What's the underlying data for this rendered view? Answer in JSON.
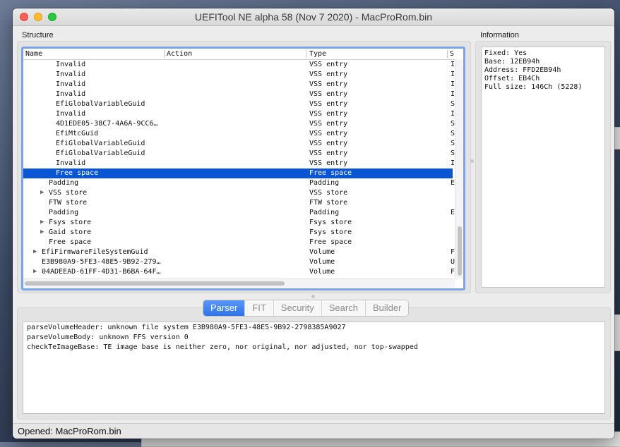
{
  "window": {
    "title": "UEFITool NE alpha 58 (Nov  7 2020) - MacProRom.bin"
  },
  "structure": {
    "label": "Structure",
    "columns": [
      "Name",
      "Action",
      "Type",
      "S"
    ],
    "rows": [
      {
        "name": "Invalid",
        "type": "VSS entry",
        "sub": "I",
        "indent": 3,
        "expandable": false,
        "selected": false
      },
      {
        "name": "Invalid",
        "type": "VSS entry",
        "sub": "I",
        "indent": 3,
        "expandable": false,
        "selected": false
      },
      {
        "name": "Invalid",
        "type": "VSS entry",
        "sub": "I",
        "indent": 3,
        "expandable": false,
        "selected": false
      },
      {
        "name": "Invalid",
        "type": "VSS entry",
        "sub": "I",
        "indent": 3,
        "expandable": false,
        "selected": false
      },
      {
        "name": "EfiGlobalVariableGuid",
        "type": "VSS entry",
        "sub": "S",
        "indent": 3,
        "expandable": false,
        "selected": false
      },
      {
        "name": "Invalid",
        "type": "VSS entry",
        "sub": "I",
        "indent": 3,
        "expandable": false,
        "selected": false
      },
      {
        "name": "4D1EDE05-38C7-4A6A-9CC6…",
        "type": "VSS entry",
        "sub": "S",
        "indent": 3,
        "expandable": false,
        "selected": false
      },
      {
        "name": "EfiMtcGuid",
        "type": "VSS entry",
        "sub": "S",
        "indent": 3,
        "expandable": false,
        "selected": false
      },
      {
        "name": "EfiGlobalVariableGuid",
        "type": "VSS entry",
        "sub": "S",
        "indent": 3,
        "expandable": false,
        "selected": false
      },
      {
        "name": "EfiGlobalVariableGuid",
        "type": "VSS entry",
        "sub": "S",
        "indent": 3,
        "expandable": false,
        "selected": false
      },
      {
        "name": "Invalid",
        "type": "VSS entry",
        "sub": "I",
        "indent": 3,
        "expandable": false,
        "selected": false
      },
      {
        "name": "Free space",
        "type": "Free space",
        "sub": "",
        "indent": 3,
        "expandable": false,
        "selected": true
      },
      {
        "name": "Padding",
        "type": "Padding",
        "sub": "E",
        "indent": 2,
        "expandable": false,
        "selected": false
      },
      {
        "name": "VSS store",
        "type": "VSS store",
        "sub": "",
        "indent": 2,
        "expandable": true,
        "selected": false
      },
      {
        "name": "FTW store",
        "type": "FTW store",
        "sub": "",
        "indent": 2,
        "expandable": false,
        "selected": false
      },
      {
        "name": "Padding",
        "type": "Padding",
        "sub": "E",
        "indent": 2,
        "expandable": false,
        "selected": false
      },
      {
        "name": "Fsys store",
        "type": "Fsys store",
        "sub": "",
        "indent": 2,
        "expandable": true,
        "selected": false
      },
      {
        "name": "Gaid store",
        "type": "Fsys store",
        "sub": "",
        "indent": 2,
        "expandable": true,
        "selected": false
      },
      {
        "name": "Free space",
        "type": "Free space",
        "sub": "",
        "indent": 2,
        "expandable": false,
        "selected": false
      },
      {
        "name": "EfiFirmwareFileSystemGuid",
        "type": "Volume",
        "sub": "F",
        "indent": 1,
        "expandable": true,
        "selected": false
      },
      {
        "name": "E3B980A9-5FE3-48E5-9B92-279…",
        "type": "Volume",
        "sub": "U",
        "indent": 1,
        "expandable": false,
        "selected": false
      },
      {
        "name": "04ADEEAD-61FF-4D31-B6BA-64F…",
        "type": "Volume",
        "sub": "F",
        "indent": 1,
        "expandable": true,
        "selected": false
      }
    ]
  },
  "information": {
    "label": "Information",
    "lines": [
      "Fixed: Yes",
      "Base: 12EB94h",
      "Address: FFD2EB94h",
      "Offset: EB4Ch",
      "Full size: 146Ch (5228)"
    ]
  },
  "tabs": [
    {
      "label": "Parser",
      "active": true
    },
    {
      "label": "FIT",
      "active": false
    },
    {
      "label": "Security",
      "active": false
    },
    {
      "label": "Search",
      "active": false
    },
    {
      "label": "Builder",
      "active": false
    }
  ],
  "log": {
    "lines": [
      "parseVolumeHeader: unknown file system E3B980A9-5FE3-48E5-9B92-2798385A9027",
      "parseVolumeBody: unknown FFS version 0",
      "checkTeImageBase: TE image base is neither zero, nor original, nor adjusted, nor top-swapped"
    ]
  },
  "status": {
    "text": "Opened: MacProRom.bin"
  },
  "colors": {
    "selection": "#0a54d6",
    "focus_ring": "#7aa3ea",
    "active_tab": "#2f74ea"
  }
}
